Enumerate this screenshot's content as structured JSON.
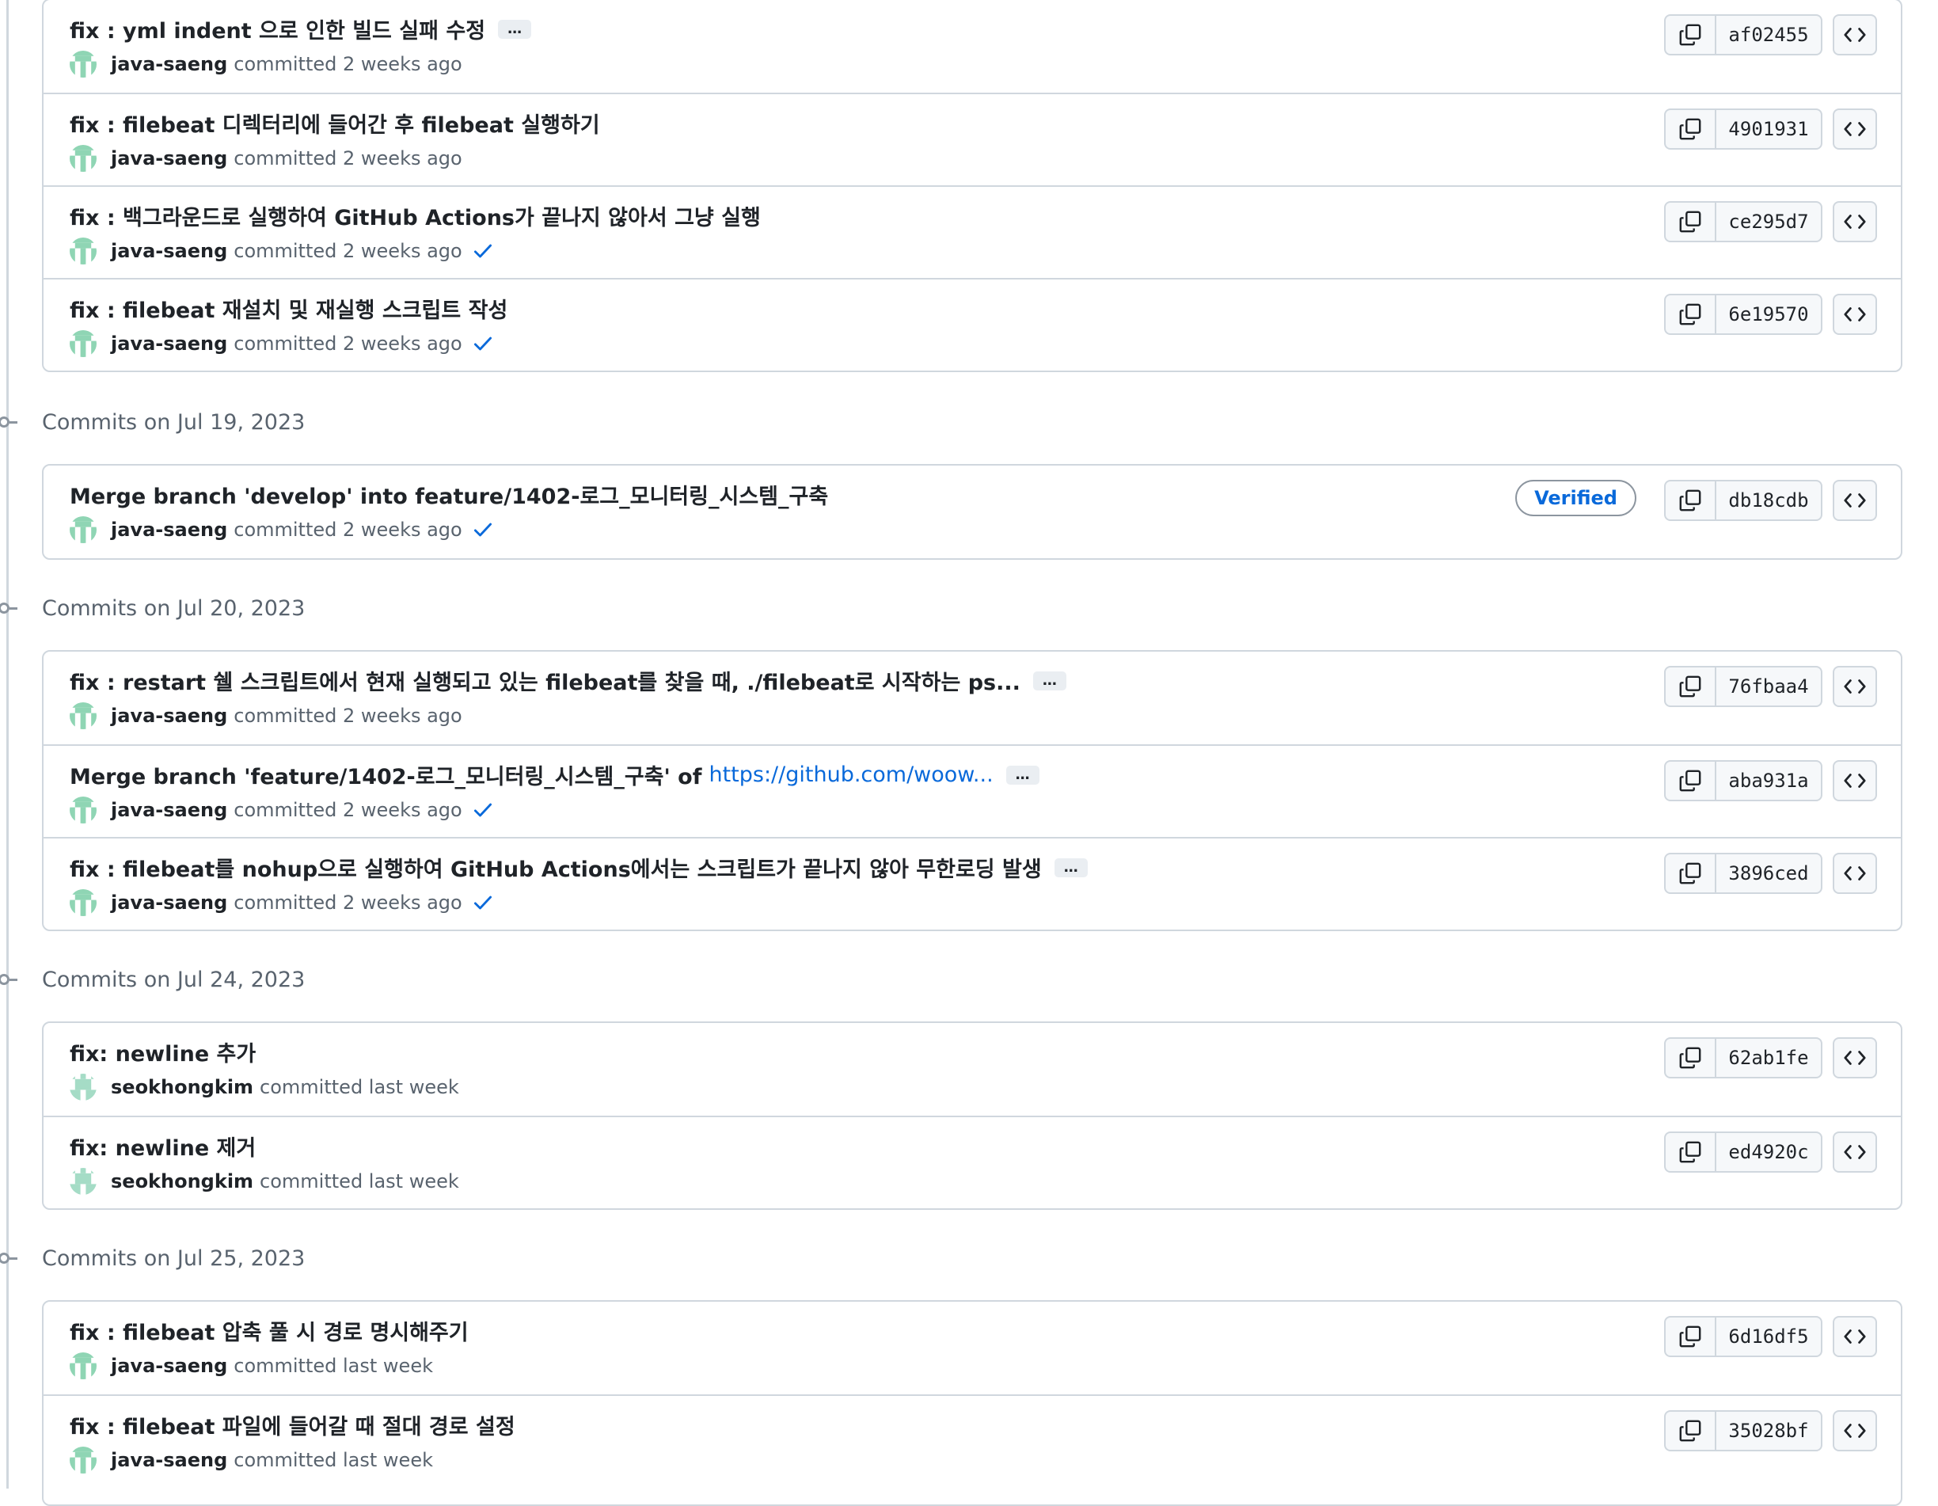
{
  "groups": [
    {
      "day_label": "",
      "commits": [
        {
          "title": "fix : yml indent 으로 인한 빌드 실패 수정",
          "author": "java-saeng",
          "when": "committed 2 weeks ago",
          "sha": "af02455",
          "ellipsis": "…",
          "check": false
        },
        {
          "title": "fix : filebeat 디렉터리에 들어간 후 filebeat 실행하기",
          "author": "java-saeng",
          "when": "committed 2 weeks ago",
          "sha": "4901931",
          "check": false
        },
        {
          "title": "fix : 백그라운드로 실행하여 GitHub Actions가 끝나지 않아서 그냥 실행",
          "author": "java-saeng",
          "when": "committed 2 weeks ago",
          "sha": "ce295d7",
          "check": true
        },
        {
          "title": "fix : filebeat 재설치 및 재실행 스크립트 작성",
          "author": "java-saeng",
          "when": "committed 2 weeks ago",
          "sha": "6e19570",
          "check": true
        }
      ]
    },
    {
      "day_label": "Commits on Jul 19, 2023",
      "commits": [
        {
          "title": "Merge branch 'develop' into feature/1402-로그_모니터링_시스템_구축",
          "author": "java-saeng",
          "when": "committed 2 weeks ago",
          "sha": "db18cdb",
          "verified": "Verified",
          "check": true
        }
      ]
    },
    {
      "day_label": "Commits on Jul 20, 2023",
      "commits": [
        {
          "title": "fix : restart 쉘 스크립트에서 현재 실행되고 있는 filebeat를 찾을 때, ./filebeat로 시작하는 ps...",
          "author": "java-saeng",
          "when": "committed 2 weeks ago",
          "sha": "76fbaa4",
          "ellipsis": "…",
          "check": false
        },
        {
          "title": "Merge branch 'feature/1402-로그_모니터링_시스템_구축' of",
          "link": "https://github.com/woow...",
          "author": "java-saeng",
          "when": "committed 2 weeks ago",
          "sha": "aba931a",
          "ellipsis": "…",
          "check": true
        },
        {
          "title": "fix : filebeat를 nohup으로 실행하여 GitHub Actions에서는 스크립트가 끝나지 않아 무한로딩 발생",
          "author": "java-saeng",
          "when": "committed 2 weeks ago",
          "sha": "3896ced",
          "ellipsis": "…",
          "check": true
        }
      ]
    },
    {
      "day_label": "Commits on Jul 24, 2023",
      "commits": [
        {
          "title": "fix: newline 추가",
          "author": "seokhongkim",
          "when": "committed last week",
          "sha": "62ab1fe",
          "check": false
        },
        {
          "title": "fix: newline 제거",
          "author": "seokhongkim",
          "when": "committed last week",
          "sha": "ed4920c",
          "check": false
        }
      ]
    },
    {
      "day_label": "Commits on Jul 25, 2023",
      "commits": [
        {
          "title": "fix : filebeat 압축 풀 시 경로 명시해주기",
          "author": "java-saeng",
          "when": "committed last week",
          "sha": "6d16df5",
          "check": false
        },
        {
          "title": "fix : filebeat 파일에 들어갈 때 절대 경로 설정",
          "author": "java-saeng",
          "when": "committed last week",
          "sha": "35028bf",
          "check": false
        }
      ]
    }
  ],
  "icons": {
    "copy": "copy-icon",
    "browse": "code-icon",
    "check": "check-icon"
  },
  "colors": {
    "link": "#0969da",
    "check": "#0969da",
    "border": "#d0d7de",
    "muted": "#59636e",
    "avatar_java": "#8fd5b4",
    "avatar_seok": "#a5dcc6"
  }
}
